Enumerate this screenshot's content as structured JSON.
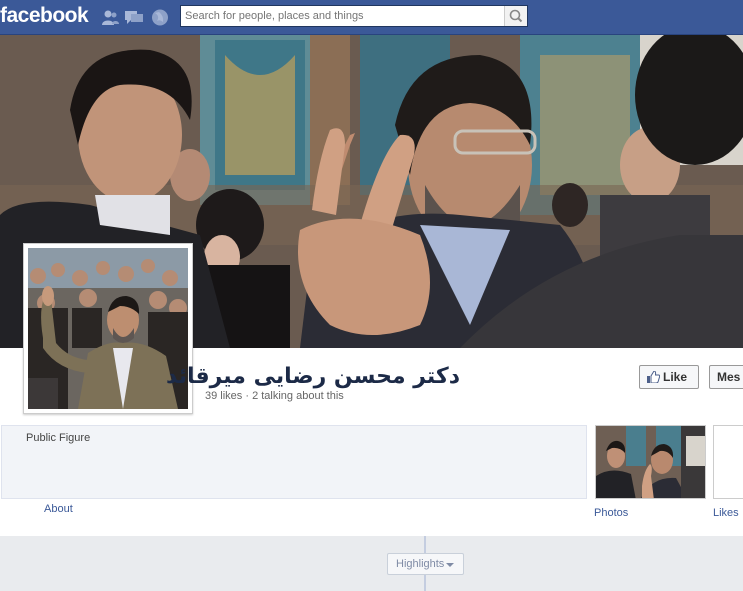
{
  "topbar": {
    "logo": "facebook",
    "search_placeholder": "Search for people, places and things",
    "icons": [
      "friend-requests-icon",
      "messages-icon",
      "notifications-icon",
      "search-icon"
    ]
  },
  "page": {
    "name": "دکتر محسن رضایی میرقائد",
    "stats": "39 likes · 2 talking about this",
    "like_label": "Like",
    "message_label": "Mes",
    "category": "Public Figure",
    "about_label": "About",
    "photos_label": "Photos",
    "likes_label": "Likes",
    "highlights_label": "Highlights"
  },
  "colors": {
    "brand": "#3b5998",
    "page_bg": "#e9ebee",
    "link": "#3b5998"
  }
}
